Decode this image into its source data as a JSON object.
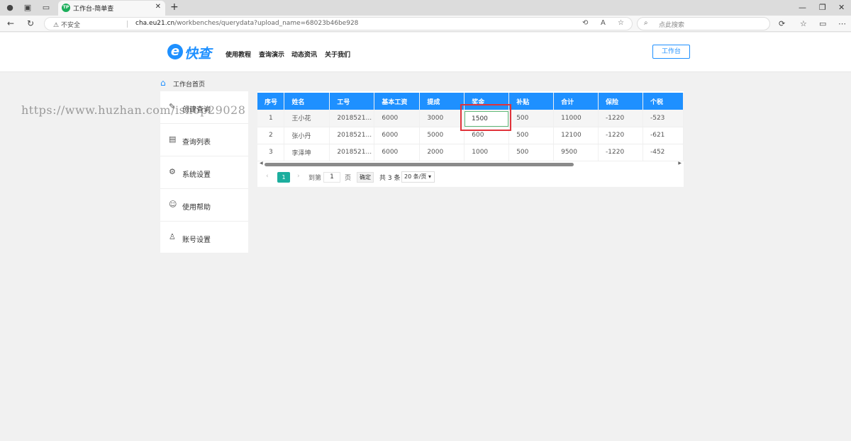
{
  "browser": {
    "tab_title": "工作台-简单查",
    "tab_favicon": "TP",
    "new_tab": "+",
    "security": "不安全",
    "url_host": "cha.eu21.cn",
    "url_path": "/workbenches/querydata?upload_name=68023b46be928",
    "search_placeholder": "点此搜索"
  },
  "site": {
    "logo_letter": "e",
    "logo_text": "快查",
    "menu": [
      "使用教程",
      "查询演示",
      "动态资讯",
      "关于我们"
    ],
    "workbench_button": "工作台"
  },
  "breadcrumb": "工作台首页",
  "sidebar": {
    "items": [
      {
        "label": "创建查询",
        "icon": "edit-doc-icon"
      },
      {
        "label": "查询列表",
        "icon": "calendar-list-icon"
      },
      {
        "label": "系统设置",
        "icon": "gear-icon"
      },
      {
        "label": "使用帮助",
        "icon": "smile-icon"
      },
      {
        "label": "账号设置",
        "icon": "user-icon"
      }
    ]
  },
  "table": {
    "headers": [
      "序号",
      "姓名",
      "工号",
      "基本工资",
      "提成",
      "奖金",
      "补贴",
      "合计",
      "保险",
      "个税"
    ],
    "rows": [
      [
        "1",
        "王小花",
        "2018521...",
        "6000",
        "3000",
        "1500",
        "500",
        "11000",
        "-1220",
        "-523"
      ],
      [
        "2",
        "张小丹",
        "2018521...",
        "6000",
        "5000",
        "600",
        "500",
        "12100",
        "-1220",
        "-621"
      ],
      [
        "3",
        "李泽坤",
        "2018521...",
        "6000",
        "2000",
        "1000",
        "500",
        "9500",
        "-1220",
        "-452"
      ]
    ],
    "editing_value": "1500"
  },
  "pager": {
    "prev": "‹",
    "current": "1",
    "next": "›",
    "goto_label": "到第",
    "goto_value": "1",
    "page_label": "页",
    "confirm": "确定",
    "total": "共 3 条",
    "page_size": "20 条/页"
  },
  "watermark": "https://www.huzhan.com/ishop29028",
  "colors": {
    "accent": "#1e90ff",
    "pager_current": "#1cae9e",
    "highlight": "#e0333a"
  }
}
